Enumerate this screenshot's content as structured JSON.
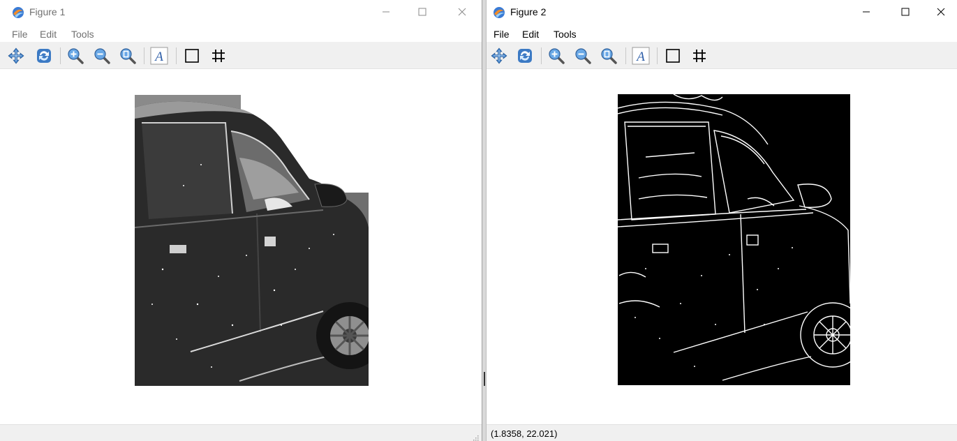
{
  "windows": [
    {
      "title": "Figure 1",
      "active": false,
      "menu": [
        "File",
        "Edit",
        "Tools"
      ],
      "status": ""
    },
    {
      "title": "Figure 2",
      "active": true,
      "menu": [
        "File",
        "Edit",
        "Tools"
      ],
      "status": "(1.8358, 22.021)"
    }
  ],
  "toolbar_icons": [
    "pan-icon",
    "reset-view-icon",
    "zoom-in-icon",
    "zoom-out-icon",
    "zoom-fit-icon",
    "text-icon",
    "box-icon",
    "grid-icon"
  ],
  "colors": {
    "toolbar_bg": "#f0f0f0",
    "inactive_text": "#707070",
    "active_text": "#000000"
  }
}
